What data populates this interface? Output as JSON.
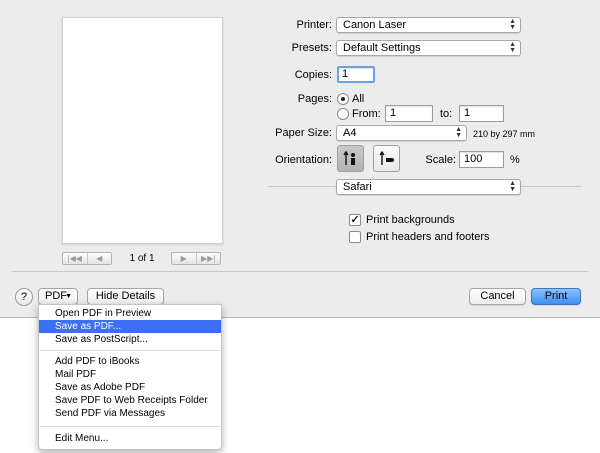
{
  "preview": {
    "page_count": "1 of 1"
  },
  "printer": {
    "label": "Printer:",
    "value": "Canon Laser"
  },
  "presets": {
    "label": "Presets:",
    "value": "Default Settings"
  },
  "copies": {
    "label": "Copies:",
    "value": "1"
  },
  "pages": {
    "label": "Pages:",
    "all_label": "All",
    "from_label": "From:",
    "from_value": "1",
    "to_label": "to:",
    "to_value": "1",
    "selected": "All"
  },
  "paper_size": {
    "label": "Paper Size:",
    "value": "A4",
    "dimensions": "210 by 297 mm"
  },
  "orientation": {
    "label": "Orientation:",
    "selected": "portrait"
  },
  "scale": {
    "label": "Scale:",
    "value": "100",
    "unit": "%"
  },
  "app_section": {
    "value": "Safari"
  },
  "options": [
    {
      "label": "Print backgrounds",
      "checked": true
    },
    {
      "label": "Print headers and footers",
      "checked": false
    }
  ],
  "footer": {
    "help_label": "?",
    "pdf_label": "PDF",
    "hide_details_label": "Hide Details",
    "cancel_label": "Cancel",
    "print_label": "Print"
  },
  "pdf_menu": {
    "group1": [
      "Open PDF in Preview",
      "Save as PDF...",
      "Save as PostScript..."
    ],
    "group2": [
      "Add PDF to iBooks",
      "Mail PDF",
      "Save as Adobe PDF",
      "Save PDF to Web Receipts Folder",
      "Send PDF via Messages"
    ],
    "group3": [
      "Edit Menu..."
    ],
    "highlighted": "Save as PDF..."
  },
  "colors": {
    "default_button": "#3c8ff2",
    "menu_highlight": "#3d6ff5",
    "focus_ring": "#6aa2e6"
  }
}
